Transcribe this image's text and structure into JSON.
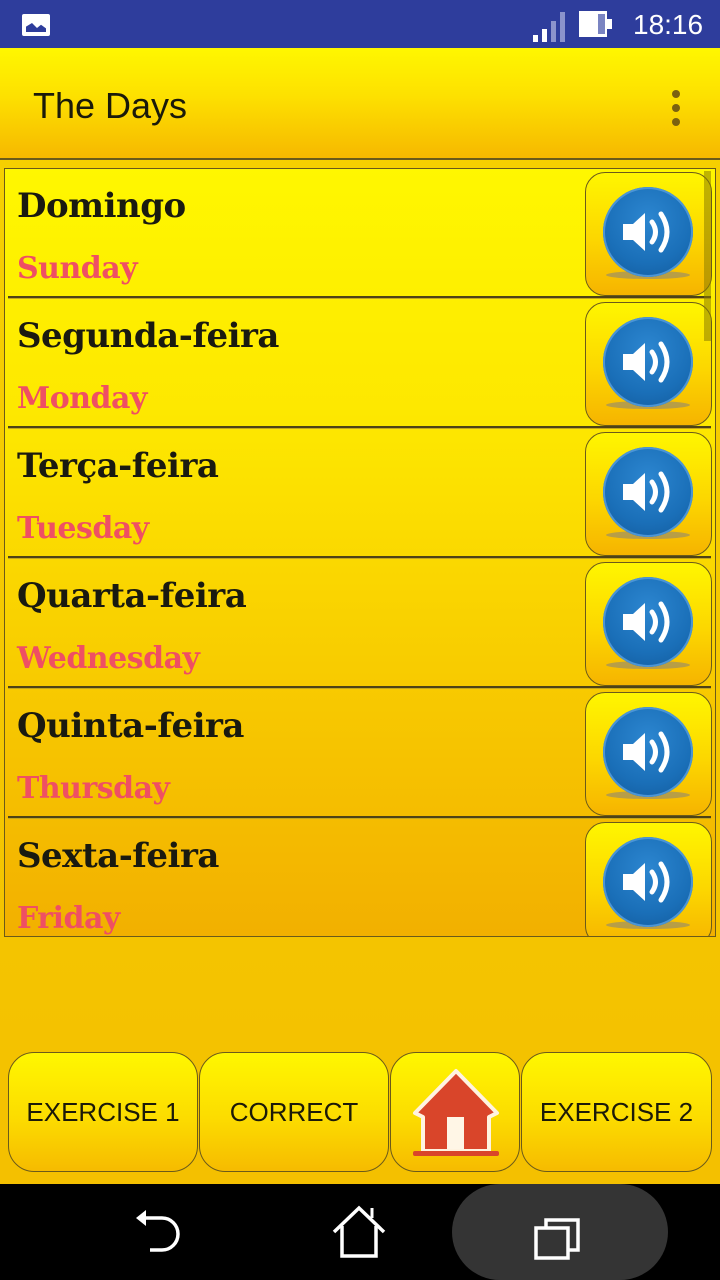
{
  "status_bar": {
    "time": "18:16",
    "icons": [
      "gallery-notification-icon",
      "signal-icon",
      "battery-icon"
    ]
  },
  "app_bar": {
    "title": "The Days",
    "overflow_icon": "more-vert-icon"
  },
  "days": [
    {
      "native": "Domingo",
      "english": "Sunday",
      "icon": "speaker-icon"
    },
    {
      "native": "Segunda-feira",
      "english": "Monday",
      "icon": "speaker-icon"
    },
    {
      "native": "Terça-feira",
      "english": "Tuesday",
      "icon": "speaker-icon"
    },
    {
      "native": "Quarta-feira",
      "english": "Wednesday",
      "icon": "speaker-icon"
    },
    {
      "native": "Quinta-feira",
      "english": "Thursday",
      "icon": "speaker-icon"
    },
    {
      "native": "Sexta-feira",
      "english": "Friday",
      "icon": "speaker-icon"
    }
  ],
  "bottom_buttons": {
    "exercise1": "EXERCISE 1",
    "correct": "CORRECT",
    "home_icon": "home-icon",
    "exercise2": "EXERCISE 2"
  },
  "nav_bar": {
    "icons": [
      "back-icon",
      "home-icon",
      "recents-icon"
    ]
  },
  "colors": {
    "status_bar": "#2e3d9c",
    "native_text": "#1a1a10",
    "english_text": "#ef4f63",
    "speaker_blue": "#1a6fb8",
    "home_red": "#d9452a"
  }
}
